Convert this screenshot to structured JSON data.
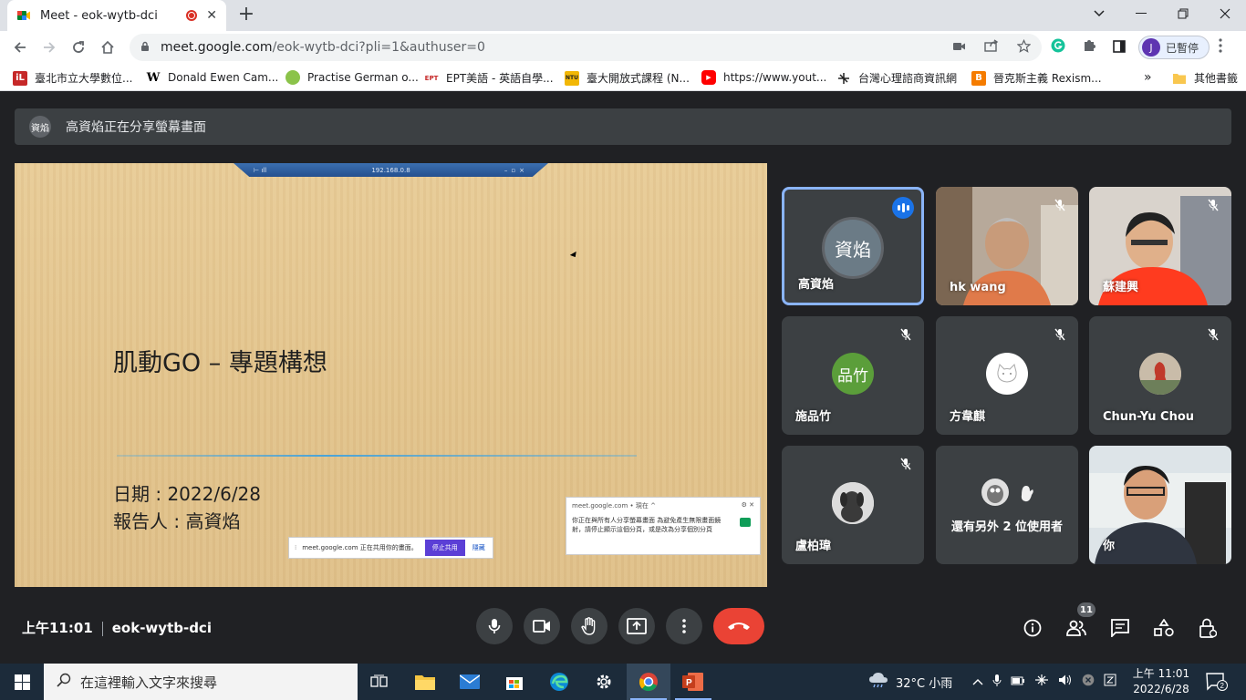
{
  "browser": {
    "tab_title": "Meet - eok-wytb-dci",
    "tab_close": "✕",
    "new_tab": "+",
    "url_host": "meet.google.com",
    "url_path": "/eok-wytb-dci?pli=1&authuser=0",
    "profile_initial": "J",
    "profile_label": "已暫停",
    "bookmarks": [
      {
        "icon": "iL",
        "label": "臺北市立大學數位..."
      },
      {
        "icon": "W",
        "label": "Donald Ewen Cam..."
      },
      {
        "icon": "",
        "label": "Practise German o..."
      },
      {
        "icon": "EPT",
        "label": "EPT美語 - 英語自學..."
      },
      {
        "icon": "NTU",
        "label": "臺大開放式課程 (N..."
      },
      {
        "icon": "▶",
        "label": "https://www.yout..."
      },
      {
        "icon": "",
        "label": "台灣心理諮商資訊網"
      },
      {
        "icon": "B",
        "label": "晉克斯主義 Rexism..."
      }
    ],
    "bookmarks_more": "»",
    "other_bookmarks": "其他書籤"
  },
  "meet": {
    "banner_avatar": "資焰",
    "banner_text": "高資焰正在分享螢幕畫面",
    "slide": {
      "title": "肌動GO – 專題構想",
      "date": "日期 : 2022/6/28",
      "reporter": "報告人 : 高資焰",
      "rdp_address": "192.168.0.8"
    },
    "share_pill": {
      "text": "meet.google.com 正在共用你的畫面。",
      "stop": "停止共用",
      "hide": "隱藏"
    },
    "notification": {
      "source": "meet.google.com • 現在 ^",
      "body": "你正在與所有人分享螢幕畫面 為避免產生無限畫面鏡射，請停止顯示這個分頁，或是改為分享個別分頁"
    },
    "participants": [
      {
        "name": "高資焰",
        "avatar": "資焰",
        "speaking": true
      },
      {
        "name": "hk wang",
        "muted": true
      },
      {
        "name": "蘇建興",
        "muted": true
      },
      {
        "name": "施品竹",
        "avatar": "品竹",
        "muted": true,
        "color": "#5b9e3a"
      },
      {
        "name": "方韋麒",
        "muted": true
      },
      {
        "name": "Chun-Yu Chou",
        "muted": true
      },
      {
        "name": "盧柏瑋",
        "muted": true
      },
      {
        "name": "還有另外 2 位使用者"
      },
      {
        "name": "你"
      }
    ],
    "time": "上午11:01",
    "meeting_code": "eok-wytb-dci",
    "people_count": "11"
  },
  "taskbar": {
    "search_placeholder": "在這裡輸入文字來搜尋",
    "weather": "32°C 小雨",
    "time": "上午 11:01",
    "date": "2022/6/28",
    "notifications": "2"
  },
  "colors": {
    "meet_bg": "#202124",
    "tile_bg": "#3c4043",
    "end_call": "#ea4335",
    "active_border": "#8ab4f8",
    "taskbar": "#1c2b3a"
  }
}
